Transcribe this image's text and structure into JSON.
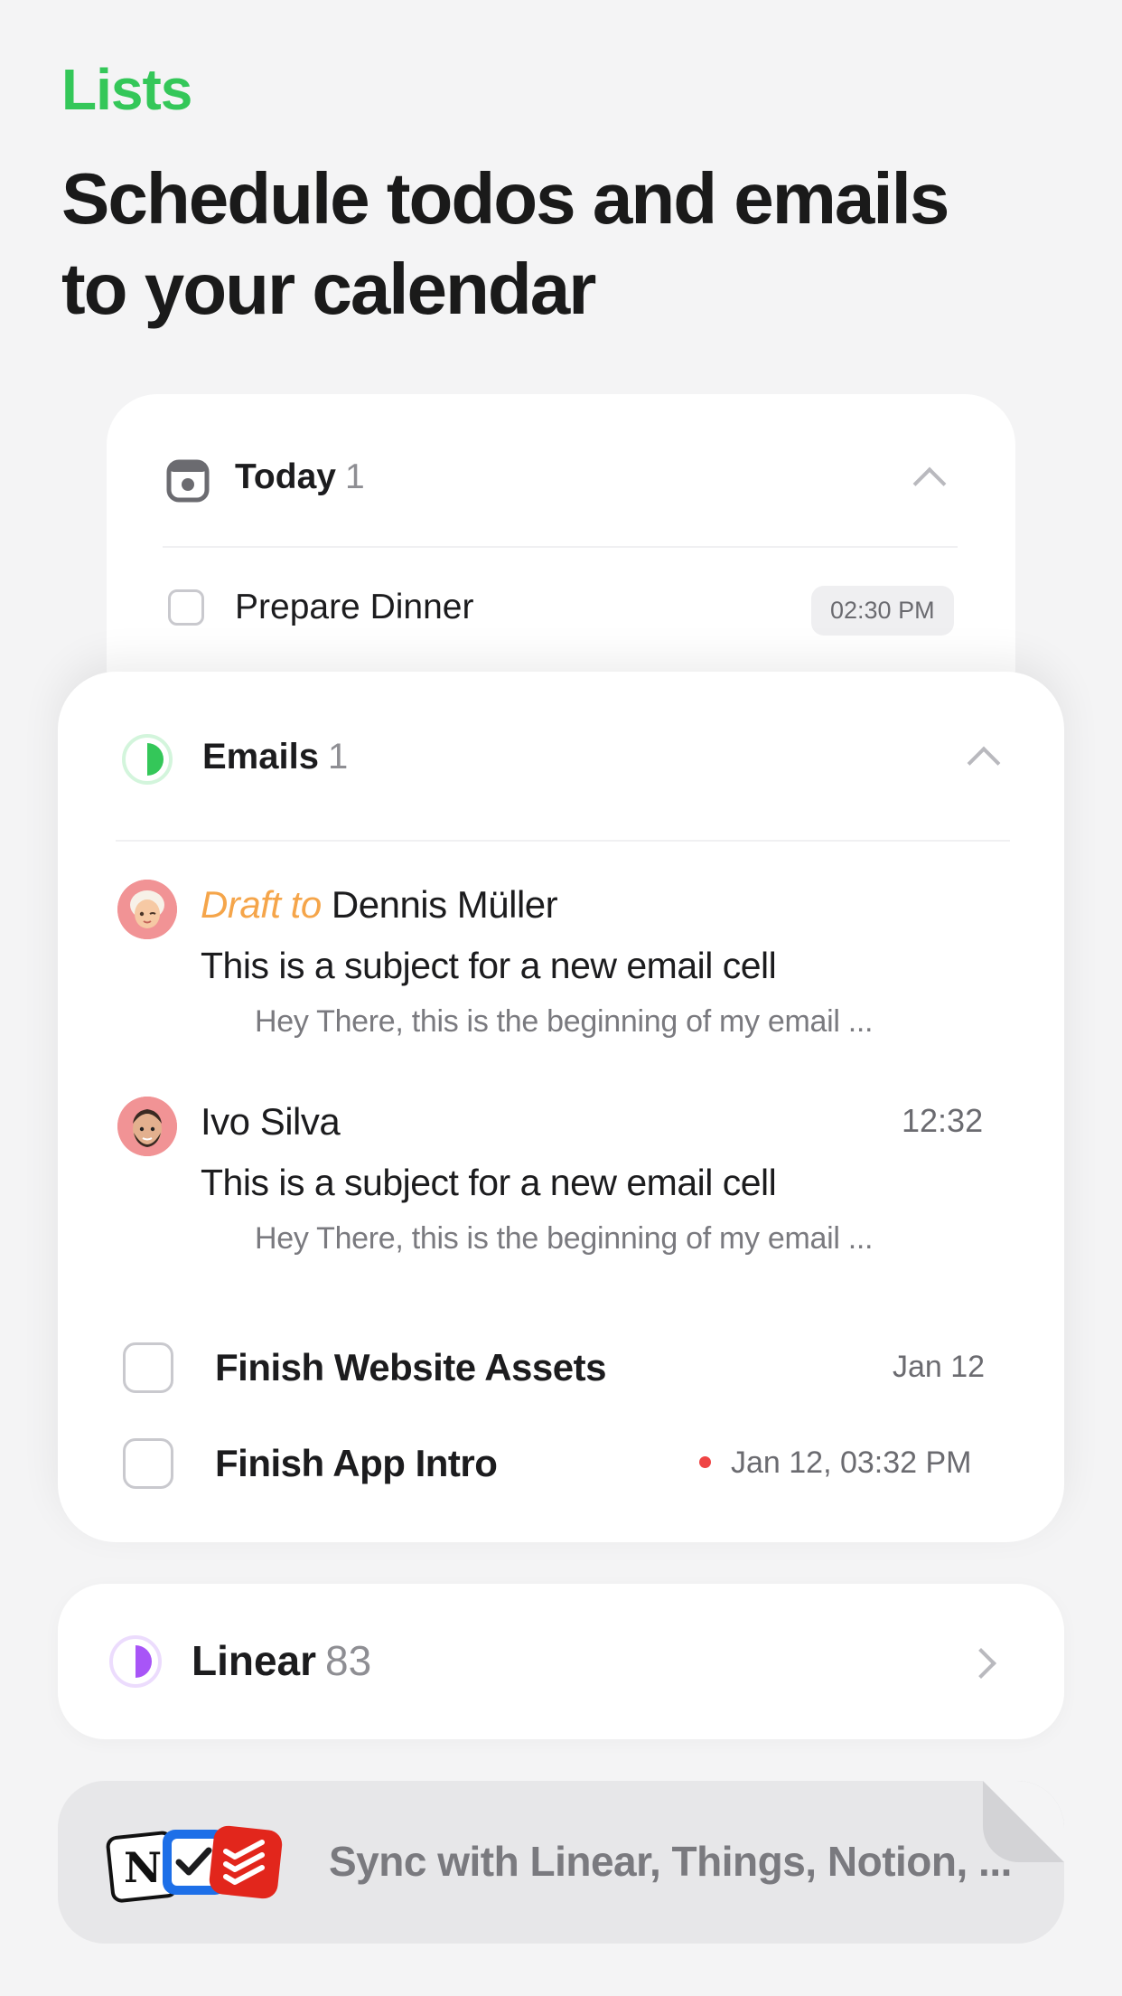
{
  "header": {
    "eyebrow": "Lists",
    "headline": "Schedule todos and emails to your calendar"
  },
  "today": {
    "title": "Today",
    "count": "1",
    "task": {
      "title": "Prepare Dinner",
      "time": "02:30 PM"
    }
  },
  "emails": {
    "title": "Emails",
    "count": "1",
    "items": [
      {
        "draft_label": "Draft to",
        "sender": "Dennis Müller",
        "subject": "This is a subject for a new email cell",
        "preview": "Hey There, this is the beginning of my email ..."
      },
      {
        "sender": "Ivo Silva",
        "time": "12:32",
        "subject": "This is a subject for a new email cell",
        "preview": "Hey There, this is the beginning of my email ..."
      }
    ],
    "tasks": [
      {
        "title": "Finish Website Assets",
        "date": "Jan 12"
      },
      {
        "title": "Finish App Intro",
        "date": "Jan 12, 03:32 PM",
        "overdue": true
      }
    ]
  },
  "linear": {
    "title": "Linear",
    "count": "83"
  },
  "sync": {
    "text": "Sync with Linear, Things, Notion, ...",
    "icons": [
      "notion-icon",
      "things-icon",
      "todoist-icon"
    ]
  },
  "colors": {
    "accent_green": "#34c759",
    "draft_orange": "#f5a54a",
    "linear_purple": "#a855f7",
    "overdue_red": "#ef4444"
  }
}
